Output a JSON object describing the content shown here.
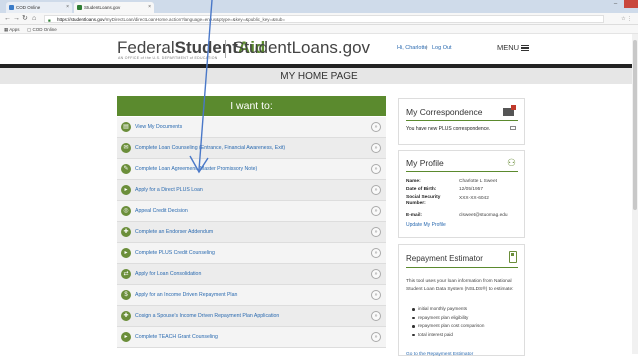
{
  "browser": {
    "tabs": [
      {
        "label": "COD Online",
        "icon_color": "#3a7bc8"
      },
      {
        "label": "StudentLoans.gov",
        "icon_color": "#2e7d32"
      }
    ],
    "url_host": "https://studentloans.gov",
    "url_path": "/myDirectLoan/directLoanHome.action?language=en-us&ptype=&key=&public_key=&sub=",
    "bookmarks": [
      {
        "label": "Apps"
      },
      {
        "label": "COD Online"
      }
    ]
  },
  "site": {
    "logo_federal": "Federal",
    "logo_student": "Student",
    "logo_aid": "Aid",
    "logo_sub": "AN OFFICE of the U.S. DEPARTMENT of EDUCATION",
    "logo_studentloans": "StudentLoans.gov",
    "greeting": "Hi, Charlotte",
    "separator": "|",
    "logout": "Log Out",
    "menu": "MENU"
  },
  "page_title": "MY HOME PAGE",
  "iwant": {
    "title": "I want to:",
    "items": [
      {
        "label": "View My Documents",
        "icon": "document-icon"
      },
      {
        "label": "Complete Loan Counseling (Entrance, Financial Awareness, Exit)",
        "icon": "counseling-icon"
      },
      {
        "label": "Complete Loan Agreement (Master Promissory Note)",
        "icon": "pencil-icon"
      },
      {
        "label": "Apply for a Direct PLUS Loan",
        "icon": "plus-loan-icon"
      },
      {
        "label": "Appeal Credit Decision",
        "icon": "appeal-icon"
      },
      {
        "label": "Complete an Endorser Addendum",
        "icon": "endorser-icon"
      },
      {
        "label": "Complete PLUS Credit Counseling",
        "icon": "credit-counseling-icon"
      },
      {
        "label": "Apply for Loan Consolidation",
        "icon": "consolidation-icon"
      },
      {
        "label": "Apply for an Income Driven Repayment Plan",
        "icon": "income-plan-icon"
      },
      {
        "label": "Cosign a Spouse's Income Driven Repayment Plan Application",
        "icon": "cosign-icon"
      },
      {
        "label": "Complete TEACH Grant Counseling",
        "icon": "teach-icon"
      }
    ]
  },
  "correspondence": {
    "title": "My Correspondence",
    "message": "You have new PLUS correspondence."
  },
  "profile": {
    "title": "My Profile",
    "fields": [
      {
        "label": "Name:",
        "value": "Charlotte L Sweet"
      },
      {
        "label": "Date of Birth:",
        "value": "12/05/1957"
      },
      {
        "label": "Social Security Number:",
        "value": "XXX-XX-6042"
      },
      {
        "label": "E-mail:",
        "value": "clsweet@stuomag.edu"
      }
    ],
    "update_link": "Update My Profile"
  },
  "repayment": {
    "title": "Repayment Estimator",
    "description": "This tool uses your loan information from National Student Loan Data System (NSLDS®) to estimate:",
    "bullets": [
      "initial monthly payments",
      "repayment plan eligibility",
      "repayment plan cost comparison",
      "total interest paid"
    ],
    "link": "Go to the Repayment Estimator"
  },
  "colors": {
    "brand_green": "#5b8a2e",
    "link_blue": "#2a6ab0",
    "annotation_arrow": "#4a78c8"
  }
}
